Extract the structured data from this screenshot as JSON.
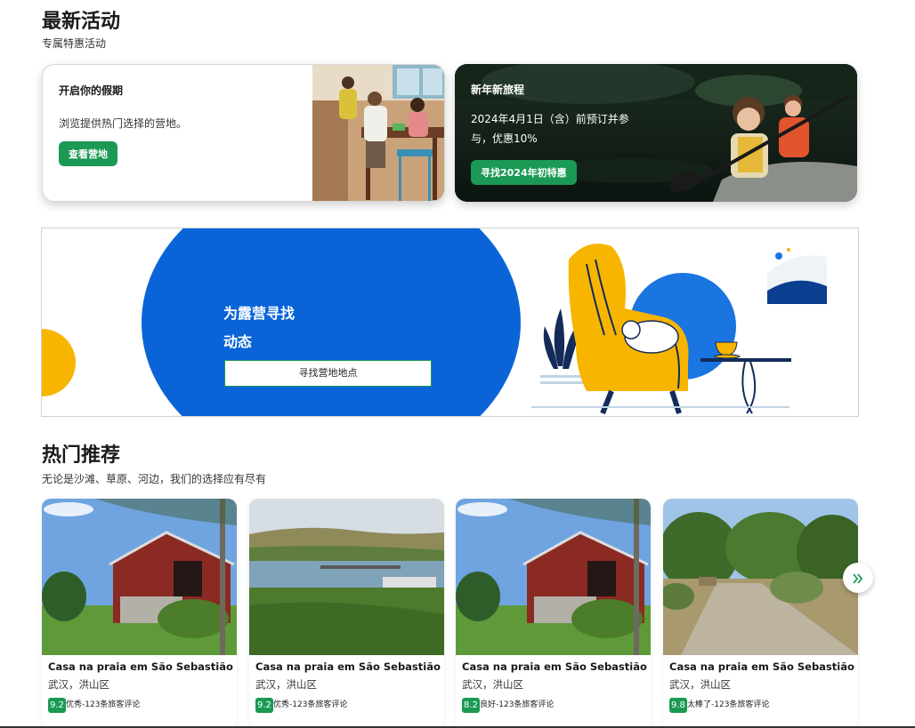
{
  "latest": {
    "title": "最新活动",
    "subtitle": "专属特惠活动"
  },
  "promo_left": {
    "title": "开启你的假期",
    "description": "浏览提供热门选择的营地。",
    "button": "查看营地"
  },
  "promo_right": {
    "title": "新年新旅程",
    "description_line1": "2024年4月1日（含）前预订并参",
    "description_line2": "与，优惠10%",
    "button": "寻找2024年初特惠"
  },
  "banner": {
    "title_line1": "为露营寻找",
    "title_line2": "动态",
    "button": "寻找营地地点"
  },
  "popular": {
    "title": "热门推荐",
    "subtitle": "无论是沙滩、草原、河边，我们的选择应有尽有"
  },
  "listings": [
    {
      "name": "Casa na praia em São Sebastião",
      "location": "武汉，洪山区",
      "score": "9.2",
      "review": "优秀-123条旅客评论"
    },
    {
      "name": "Casa na praia em São Sebastião",
      "location": "武汉，洪山区",
      "score": "9.2",
      "review": "优秀-123条旅客评论"
    },
    {
      "name": "Casa na praia em São Sebastião",
      "location": "武汉，洪山区",
      "score": "8.2",
      "review": "良好-123条旅客评论"
    },
    {
      "name": "Casa na praia em São Sebastião",
      "location": "武汉，洪山区",
      "score": "9.8",
      "review": "太棒了-123条旅客评论"
    }
  ],
  "next_icon": "double-chevron-right-icon",
  "colors": {
    "accent_green": "#1a9a54",
    "banner_blue": "#0a64d8",
    "chair_yellow": "#f7b500"
  }
}
